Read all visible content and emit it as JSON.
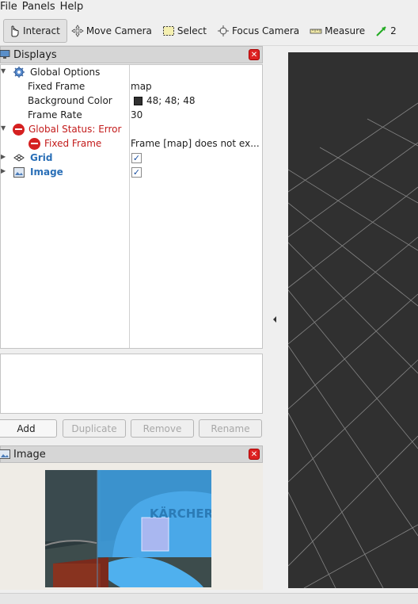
{
  "menu": [
    {
      "label": "File"
    },
    {
      "label": "Panels"
    },
    {
      "label": "Help"
    }
  ],
  "toolbar": {
    "interact": "Interact",
    "move_camera": "Move Camera",
    "select": "Select",
    "focus_camera": "Focus Camera",
    "measure": "Measure",
    "pose_estimate": "2"
  },
  "displays_panel": {
    "title": "Displays",
    "close": "✕",
    "global_options": "Global Options",
    "fixed_frame_label": "Fixed Frame",
    "fixed_frame_value": "map",
    "bg_color_label": "Background Color",
    "bg_color_value": "48; 48; 48",
    "bg_color_hex": "#303030",
    "frame_rate_label": "Frame Rate",
    "frame_rate_value": "30",
    "global_status": "Global Status: Error",
    "status_fixed_frame": "Fixed Frame",
    "status_message": "Frame [map] does not ex...",
    "grid": "Grid",
    "grid_checked": "✓",
    "image": "Image",
    "image_checked": "✓"
  },
  "buttons": {
    "add": "Add",
    "duplicate": "Duplicate",
    "remove": "Remove",
    "rename": "Rename"
  },
  "image_panel": {
    "title": "Image",
    "close": "✕",
    "overlay_text": "KÄRCHER"
  },
  "colors": {
    "error": "#c31b1b",
    "link": "#2a6fb7",
    "viewport_bg": "#303030",
    "segmentation_blue": "#3ea2e6"
  }
}
